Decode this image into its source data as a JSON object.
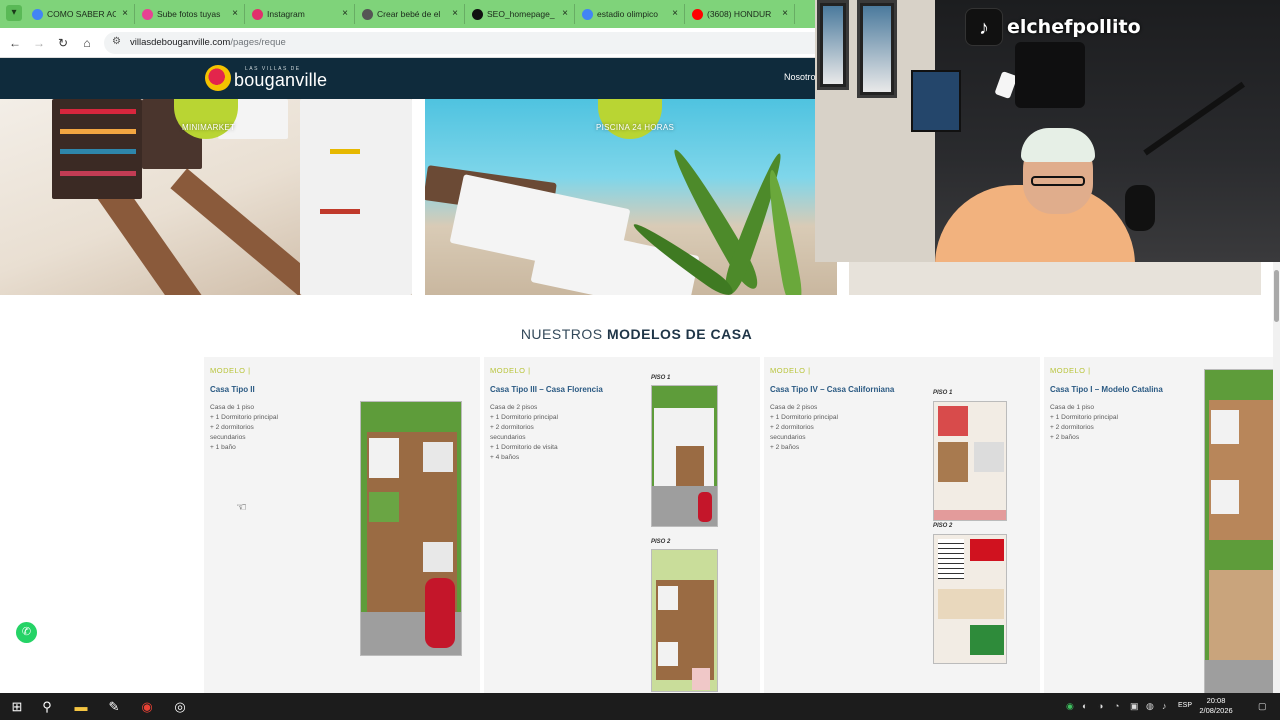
{
  "browser": {
    "tabs": [
      {
        "title": "COMO SABER AC",
        "favicon_color": "#4285f4",
        "active": false
      },
      {
        "title": "Sube fotos tuyas",
        "favicon_color": "#e84393",
        "active": false
      },
      {
        "title": "Instagram",
        "favicon_color": "#e1306c",
        "active": false
      },
      {
        "title": "Crear bebé de el",
        "favicon_color": "#555555",
        "active": false
      },
      {
        "title": "SEO_homepage_",
        "favicon_color": "#111111",
        "active": false
      },
      {
        "title": "estadio olimpico",
        "favicon_color": "#4285f4",
        "active": false
      },
      {
        "title": "(3608) HONDUR",
        "favicon_color": "#ff0000",
        "active": false
      }
    ],
    "tab_close": "×",
    "url_host": "villasdebouganville.com",
    "url_path": "/pages/reque"
  },
  "site": {
    "logo_small": "LAS VILLAS DE",
    "logo_big": "bouganville",
    "nav_first": "Nosotro",
    "amenities": [
      {
        "label": "MINIMARKET"
      },
      {
        "label": "PISCINA 24 HORAS"
      }
    ],
    "section_title_light": "NUESTROS ",
    "section_title_bold": "MODELOS DE CASA",
    "models": [
      {
        "label": "MODELO |",
        "title": "Casa Tipo II",
        "desc": [
          "Casa de 1 piso",
          "+ 1 Dormitorio principal",
          "+ 2 dormitorios",
          "secundarios",
          "+ 1 baño"
        ],
        "floors": []
      },
      {
        "label": "MODELO |",
        "title": "Casa Tipo III – Casa Florencia",
        "desc": [
          "Casa de 2 pisos",
          "+ 1 Dormitorio principal",
          "+ 2 dormitorios",
          "secundarios",
          "+ 1 Dormitorio de visita",
          "+ 4 baños"
        ],
        "floors": [
          "PISO 1",
          "PISO 2"
        ]
      },
      {
        "label": "MODELO |",
        "title": "Casa Tipo IV – Casa Californiana",
        "desc": [
          "Casa de 2 pisos",
          "+ 1 Dormitorio principal",
          "+ 2 dormitorios",
          "secundarios",
          "+ 2 baños"
        ],
        "floors": [
          "PISO 1",
          "PISO 2"
        ]
      },
      {
        "label": "MODELO |",
        "title": "Casa Tipo I – Modelo Catalina",
        "desc": [
          "Casa de 1 piso",
          "+ 1 Dormitorio principal",
          "+ 2 dormitorios",
          "+ 2 baños"
        ],
        "floors": []
      }
    ]
  },
  "overlay": {
    "tiktok_handle": "elchefpollito"
  },
  "taskbar": {
    "lang": "ESP",
    "time": "20:08",
    "date": "2/08/2026"
  },
  "colors": {
    "tab_strip": "#7fd37a",
    "header_bg": "#0f2b3c",
    "model_label": "#b8c43a",
    "model_title": "#2b5a83",
    "whatsapp": "#25d366"
  }
}
